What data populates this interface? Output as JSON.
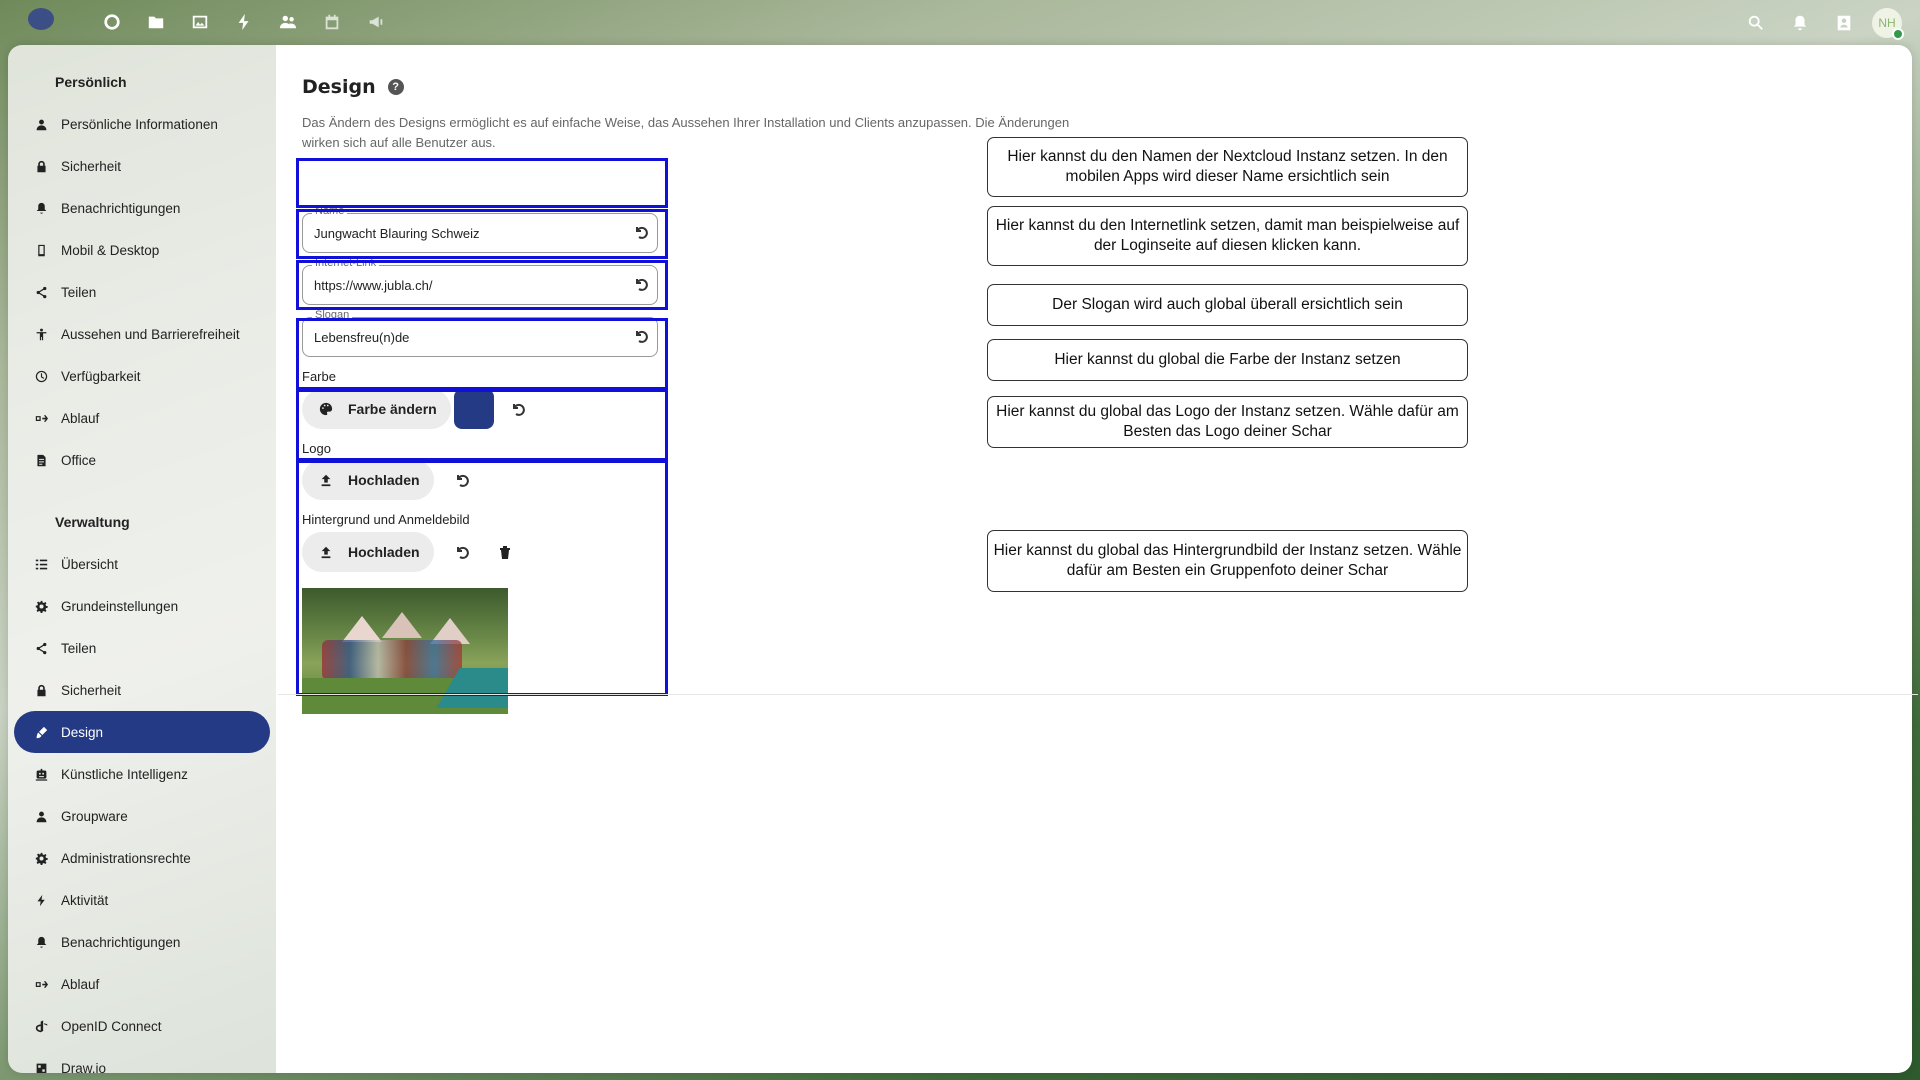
{
  "header": {
    "apps": [
      "dashboard-icon",
      "files-icon",
      "photos-icon",
      "activity-icon",
      "contacts-icon",
      "calendar-icon",
      "announcements-icon"
    ],
    "avatar_initials": "NH"
  },
  "sidebar": {
    "personal_caption": "Persönlich",
    "personal_items": [
      {
        "label": "Persönliche Informationen",
        "icon": "user-icon"
      },
      {
        "label": "Sicherheit",
        "icon": "lock-icon"
      },
      {
        "label": "Benachrichtigungen",
        "icon": "bell-icon"
      },
      {
        "label": "Mobil & Desktop",
        "icon": "phone-icon"
      },
      {
        "label": "Teilen",
        "icon": "share-icon"
      },
      {
        "label": "Aussehen und Barrierefreiheit",
        "icon": "accessibility-icon"
      },
      {
        "label": "Verfügbarkeit",
        "icon": "clock-icon"
      },
      {
        "label": "Ablauf",
        "icon": "flow-icon"
      },
      {
        "label": "Office",
        "icon": "document-icon"
      }
    ],
    "admin_caption": "Verwaltung",
    "admin_items": [
      {
        "label": "Übersicht",
        "icon": "list-icon"
      },
      {
        "label": "Grundeinstellungen",
        "icon": "gear-icon"
      },
      {
        "label": "Teilen",
        "icon": "share-icon"
      },
      {
        "label": "Sicherheit",
        "icon": "lock-icon"
      },
      {
        "label": "Design",
        "icon": "brush-icon"
      },
      {
        "label": "Künstliche Intelligenz",
        "icon": "robot-icon"
      },
      {
        "label": "Groupware",
        "icon": "groupware-icon"
      },
      {
        "label": "Administrationsrechte",
        "icon": "gear-icon"
      },
      {
        "label": "Aktivität",
        "icon": "activity-icon"
      },
      {
        "label": "Benachrichtigungen",
        "icon": "bell-icon"
      },
      {
        "label": "Ablauf",
        "icon": "flow-icon"
      },
      {
        "label": "OpenID Connect",
        "icon": "openid-icon"
      },
      {
        "label": "Draw.io",
        "icon": "drawio-icon"
      }
    ]
  },
  "design": {
    "title": "Design",
    "description": "Das Ändern des Designs ermöglicht es auf einfache Weise, das Aussehen Ihrer Installation und Clients anzupassen. Die Änderungen wirken sich auf alle Benutzer aus.",
    "name_label": "Name",
    "name_value": "Jungwacht Blauring Schweiz",
    "link_label": "Internet-Link",
    "link_value": "https://www.jubla.ch/",
    "slogan_label": "Slogan",
    "slogan_value": "Lebensfreu(n)de",
    "color_label": "Farbe",
    "color_button": "Farbe ändern",
    "primary_color": "#253a85",
    "logo_label": "Logo",
    "logo_button": "Hochladen",
    "background_label": "Hintergrund und Anmeldebild",
    "background_button": "Hochladen"
  },
  "annotations": [
    "Hier kannst du den Namen der Nextcloud Instanz setzen. In den mobilen Apps wird dieser Name ersichtlich sein",
    "Hier kannst du den Internetlink setzen, damit man beispielweise auf der Loginseite auf diesen klicken kann.",
    "Der Slogan wird auch global überall ersichtlich sein",
    "Hier kannst du global die Farbe der Instanz setzen",
    "Hier kannst du global das Logo der Instanz setzen. Wähle dafür am Besten das Logo deiner Schar",
    "Hier kannst du global das Hintergrundbild der Instanz setzen. Wähle dafür am Besten ein Gruppenfoto deiner Schar"
  ],
  "colors": {
    "accent": "#253a85",
    "highlight": "#1010d8"
  }
}
